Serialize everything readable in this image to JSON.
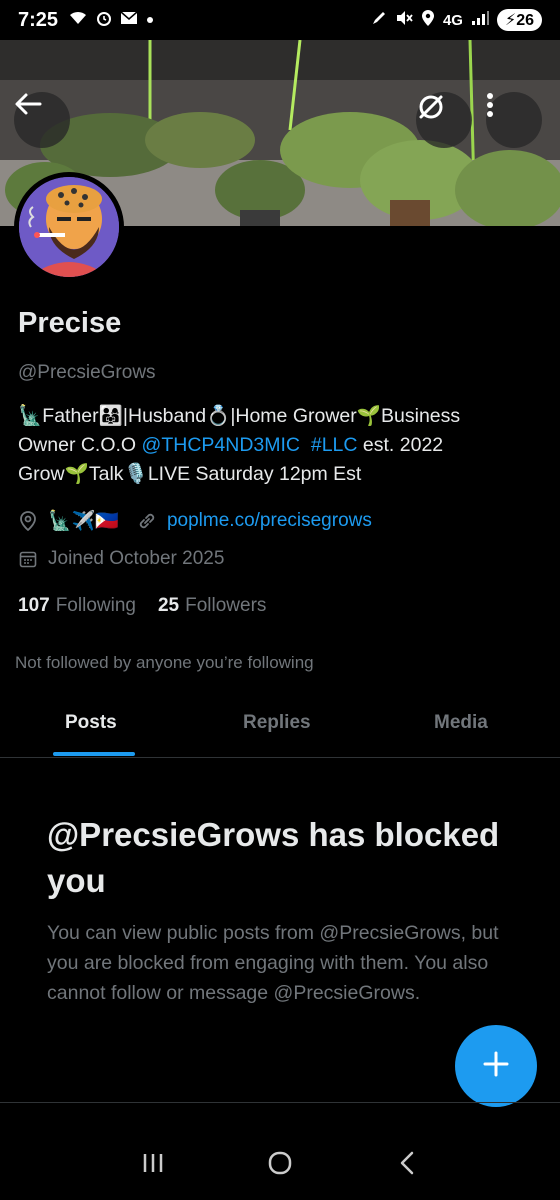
{
  "status_bar": {
    "time": "7:25",
    "network": "4G",
    "battery": "26"
  },
  "profile": {
    "name": "Precise",
    "handle": "@PrecsieGrows",
    "bio": {
      "line1_prefix": "🗽Father👨‍👩‍👧|Husband💍|Home Grower🌱Business",
      "line2_prefix": "Owner C.O.O ",
      "line2_mention": "@THCP4ND3MIC",
      "line2_hashtag": "#LLC",
      "line2_suffix": " est. 2022",
      "line3": "Grow🌱Talk🎙️LIVE Saturday 12pm Est"
    },
    "location": "🗽✈️🇵🇭",
    "website": "poplme.co/precisegrows",
    "joined": "Joined October 2025",
    "following_count": "107",
    "following_label": "Following",
    "followers_count": "25",
    "followers_label": "Followers",
    "not_followed": "Not followed by anyone you’re following"
  },
  "tabs": [
    {
      "label": "Posts",
      "active": true
    },
    {
      "label": "Replies",
      "active": false
    },
    {
      "label": "Media",
      "active": false
    }
  ],
  "blocked": {
    "title": "@PrecsieGrows has blocked you",
    "description": "You can view public posts from @PrecsieGrows, but you are blocked from engaging with them. You also cannot follow or message @PrecsieGrows."
  },
  "icons": {
    "back": "arrow-left-icon",
    "explore": "explore-icon",
    "more": "more-vertical-icon",
    "location": "location-icon",
    "link": "link-icon",
    "calendar": "calendar-icon",
    "compose": "plus-icon"
  },
  "colors": {
    "accent": "#1d9bf0",
    "background": "#000000",
    "primary_text": "#e7e9ea",
    "secondary_text": "#71767b"
  }
}
